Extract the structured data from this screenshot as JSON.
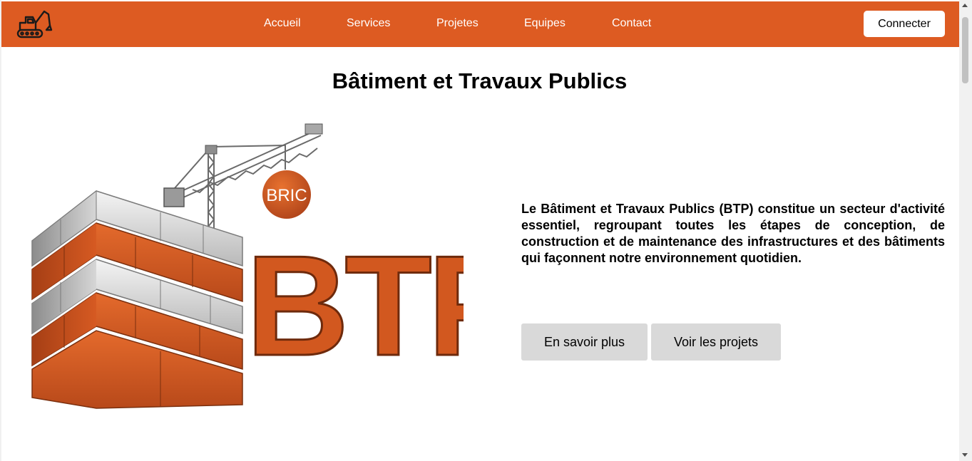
{
  "nav": {
    "links": [
      {
        "label": "Accueil"
      },
      {
        "label": "Services"
      },
      {
        "label": "Projetes"
      },
      {
        "label": "Equipes"
      },
      {
        "label": "Contact"
      }
    ],
    "connect_label": "Connecter",
    "logo_icon": "excavator-icon"
  },
  "colors": {
    "brand_orange": "#dd5b22",
    "brick_orange": "#d2581f",
    "button_gray": "#d9d9d9"
  },
  "hero": {
    "title": "Bâtiment et Travaux Publics",
    "description": "Le Bâtiment et Travaux Publics (BTP) constitue un secteur d'activité essentiel, regroupant toutes les étapes de conception, de construction et de maintenance des infrastructures et des bâtiments qui façonnent notre environnement quotidien.",
    "buttons": {
      "more_label": "En savoir plus",
      "projects_label": "Voir les projets"
    },
    "illustration": {
      "badge_text": "BRIC",
      "logo_text": "BTP",
      "icon": "crane-brick-wall-illustration"
    }
  }
}
